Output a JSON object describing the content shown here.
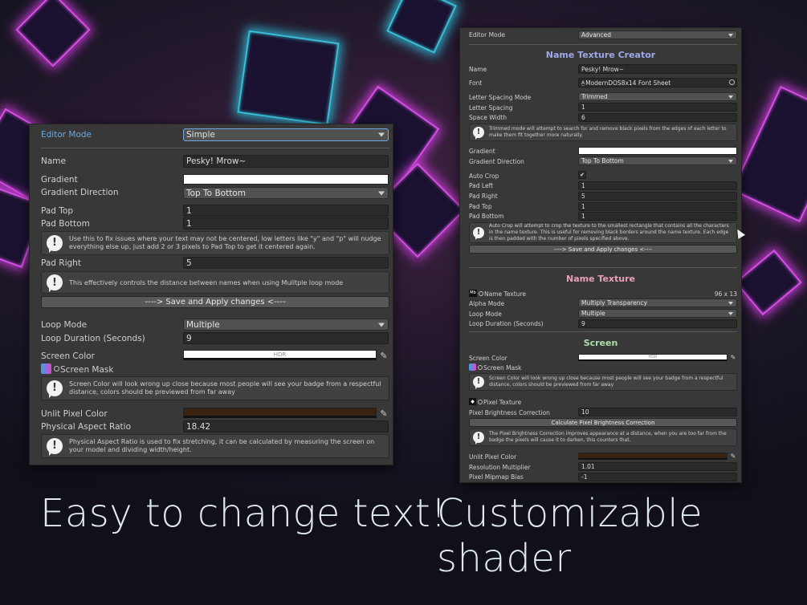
{
  "captions": {
    "left": "Easy to change text!",
    "right": "Customizable shader"
  },
  "left_panel": {
    "editor_mode": {
      "label": "Editor Mode",
      "value": "Simple"
    },
    "name": {
      "label": "Name",
      "value": "Pesky! Mrow~"
    },
    "gradient": {
      "label": "Gradient"
    },
    "gradient_direction": {
      "label": "Gradient Direction",
      "value": "Top To Bottom"
    },
    "pad_top": {
      "label": "Pad Top",
      "value": "1"
    },
    "pad_bottom": {
      "label": "Pad Bottom",
      "value": "1"
    },
    "help_pad": "Use this to fix issues where your text may not be centered, low letters like \"y\" and \"p\" will nudge everything else up, just add 2 or 3 pixels to Pad Top to get it centered again.",
    "pad_right": {
      "label": "Pad Right",
      "value": "5"
    },
    "help_pad_right": "This effectively controls the distance between names when using Mulitple loop mode",
    "save_button": "----> Save and Apply changes <----",
    "loop_mode": {
      "label": "Loop Mode",
      "value": "Multiple"
    },
    "loop_duration": {
      "label": "Loop Duration (Seconds)",
      "value": "9"
    },
    "screen_color": {
      "label": "Screen Color",
      "hdr": "HDR"
    },
    "screen_mask": {
      "label": "Screen Mask"
    },
    "help_screen_color": "Screen Color will look wrong up close because most people will see your badge from a respectful distance, colors should be previewed from far away",
    "unlit_pixel_color": {
      "label": "Unlit Pixel Color"
    },
    "physical_aspect_ratio": {
      "label": "Physical Aspect Ratio",
      "value": "18.42"
    },
    "help_aspect": "Physical Aspect Ratio is used to fix stretching, it can be calculated by measuring the screen on your model and dividing width/height.",
    "colors": {
      "editor_mode_label": "#6fa8dc",
      "unlit": "#3a2210"
    }
  },
  "right_panel": {
    "editor_mode": {
      "label": "Editor Mode",
      "value": "Advanced"
    },
    "title_name_texture_creator": "Name Texture Creator",
    "name": {
      "label": "Name",
      "value": "Pesky! Mrow~"
    },
    "font": {
      "label": "Font",
      "value": "ModernDOS8x14 Font Sheet"
    },
    "letter_spacing_mode": {
      "label": "Letter Spacing Mode",
      "value": "Trimmed"
    },
    "letter_spacing": {
      "label": "Letter Spacing",
      "value": "1"
    },
    "space_width": {
      "label": "Space Width",
      "value": "6"
    },
    "help_trimmed": "Trimmed mode will attempt to search for and remove black pixels from the edges of each letter to make them fit together more naturally.",
    "gradient": {
      "label": "Gradient"
    },
    "gradient_direction": {
      "label": "Gradient Direction",
      "value": "Top To Bottom"
    },
    "auto_crop": {
      "label": "Auto Crop",
      "value": "✔"
    },
    "pad_left": {
      "label": "Pad Left",
      "value": "1"
    },
    "pad_right": {
      "label": "Pad Right",
      "value": "5"
    },
    "pad_top": {
      "label": "Pad Top",
      "value": "1"
    },
    "pad_bottom": {
      "label": "Pad Bottom",
      "value": "1"
    },
    "help_auto_crop": "Auto Crop will attempt to crop the texture to the smallest rectangle that contains all the characters in the name texture. This is useful for removing black borders around the name texture. Each edge is then padded with the number of pixels specified above.",
    "save_button": "----> Save and Apply changes <----",
    "title_name_texture": "Name Texture",
    "name_texture": {
      "label": "Name Texture",
      "size": "96 x 13"
    },
    "alpha_mode": {
      "label": "Alpha Mode",
      "value": "Multiply Transparency"
    },
    "loop_mode": {
      "label": "Loop Mode",
      "value": "Multiple"
    },
    "loop_duration": {
      "label": "Loop Duration (Seconds)",
      "value": "9"
    },
    "title_screen": "Screen",
    "screen_color": {
      "label": "Screen Color",
      "hdr": "HDR"
    },
    "screen_mask": {
      "label": "Screen Mask"
    },
    "help_screen_color": "Screen Color will look wrong up close because most people will see your badge from a respectful distance, colors should be previewed from far away",
    "pixel_texture": {
      "label": "Pixel Texture"
    },
    "pixel_brightness_correction": {
      "label": "Pixel Brightness Correction",
      "value": "10"
    },
    "calc_button": "Calculate Pixel Brightness Correction",
    "help_brightness": "The Pixel Brightness Correction improves appearance at a distance, when you are too far from the badge the pixels will cause it to darken, this counters that.",
    "unlit_pixel_color": {
      "label": "Unlit Pixel Color"
    },
    "resolution_multiplier": {
      "label": "Resolution Multiplier",
      "value": "1.01"
    },
    "pixel_mipmap_bias": {
      "label": "Pixel Mipmap Bias",
      "value": "-1"
    },
    "colors": {
      "title_creator": "#9fa8e8",
      "title_name_texture": "#e8a0b8",
      "title_screen": "#a8e0a8",
      "unlit": "#3a2210"
    }
  }
}
